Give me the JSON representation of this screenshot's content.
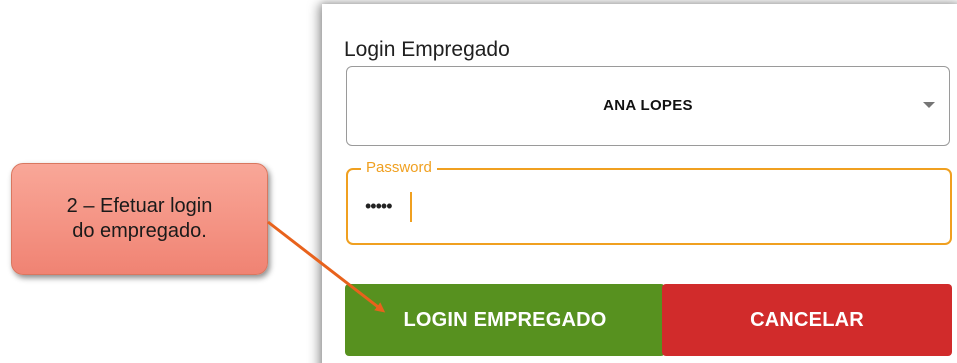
{
  "dialog": {
    "title": "Login Empregado",
    "employee_select": {
      "value": "ANA LOPES"
    },
    "password": {
      "label": "Password",
      "masked_value": "•••••"
    },
    "buttons": {
      "login": "LOGIN EMPREGADO",
      "cancel": "CANCELAR"
    }
  },
  "annotation": {
    "text": "2 – Efetuar login\ndo empregado."
  },
  "colors": {
    "accent": "#f0a020",
    "login_button": "#57911f",
    "cancel_button": "#d12b2b",
    "callout": "#f08373"
  }
}
